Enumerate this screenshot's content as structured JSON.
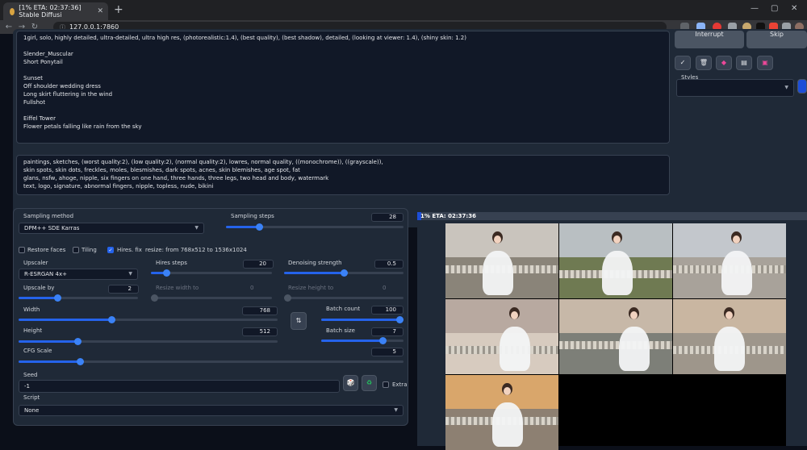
{
  "browser": {
    "tab_title": "[1% ETA: 02:37:36] Stable Diffusi",
    "url": "127.0.0.1:7860"
  },
  "positive_prompt": "1girl, solo, highly detailed, ultra-detailed, ultra high res, (photorealistic:1.4), (best quality), (best shadow), detailed, (looking at viewer: 1.4), (shiny skin: 1.2)\n\nSlender_Muscular\nShort Ponytail\n\nSunset\nOff shoulder wedding dress\nLong skirt fluttering in the wind\nFullshot\n\nEiffel Tower\nFlower petals falling like rain from the sky",
  "negative_prompt": "paintings, sketches, (worst quality:2), (low quality:2), (normal quality:2), lowres, normal quality, ((monochrome)), ((grayscale)),\nskin spots, skin dots, freckles, moles, blesmishes, dark spots, acnes, skin blemishes, age spot, fat\nglans, nsfw, ahoge, nipple, six fingers on one hand, three hands, three legs, two head and body, watermark\ntext, logo, signature, abnormal fingers, nipple, topless, nude, bikini",
  "top_buttons": {
    "interrupt": "Interrupt",
    "skip": "Skip"
  },
  "tool_icons": [
    "check-icon",
    "trash-icon",
    "paint-icon",
    "clipboard-icon",
    "save-icon"
  ],
  "styles": {
    "label": "Styles",
    "value": ""
  },
  "sampling_method": {
    "label": "Sampling method",
    "value": "DPM++ SDE Karras"
  },
  "sampling_steps": {
    "label": "Sampling steps",
    "value": "28",
    "fraction": 0.19
  },
  "checks": {
    "restore_faces": "Restore faces",
    "tiling": "Tiling",
    "hires_fix": "Hires. fix",
    "resize_info": "resize: from 768x512 to 1536x1024"
  },
  "upscaler": {
    "label": "Upscaler",
    "value": "R-ESRGAN 4x+"
  },
  "hires_steps": {
    "label": "Hires steps",
    "value": "20",
    "fraction": 0.13
  },
  "denoising": {
    "label": "Denoising strength",
    "value": "0.5",
    "fraction": 0.5
  },
  "upscale_by": {
    "label": "Upscale by",
    "value": "2",
    "fraction": 0.33
  },
  "resize_width": {
    "label": "Resize width to",
    "value": "0"
  },
  "resize_height": {
    "label": "Resize height to",
    "value": "0"
  },
  "width": {
    "label": "Width",
    "value": "768",
    "fraction": 0.36
  },
  "height": {
    "label": "Height",
    "value": "512",
    "fraction": 0.23
  },
  "batch_count": {
    "label": "Batch count",
    "value": "100",
    "fraction": 1.0
  },
  "batch_size": {
    "label": "Batch size",
    "value": "7",
    "fraction": 0.75
  },
  "cfg_scale": {
    "label": "CFG Scale",
    "value": "5",
    "fraction": 0.16
  },
  "seed": {
    "label": "Seed",
    "value": "-1",
    "extra": "Extra"
  },
  "script": {
    "label": "Script",
    "value": "None"
  },
  "progress": {
    "text": "1% ETA: 02:37:36",
    "fraction": 0.01
  },
  "colors": {
    "accent": "#2563eb",
    "panel": "#1f2937",
    "background": "#0b0f19"
  }
}
